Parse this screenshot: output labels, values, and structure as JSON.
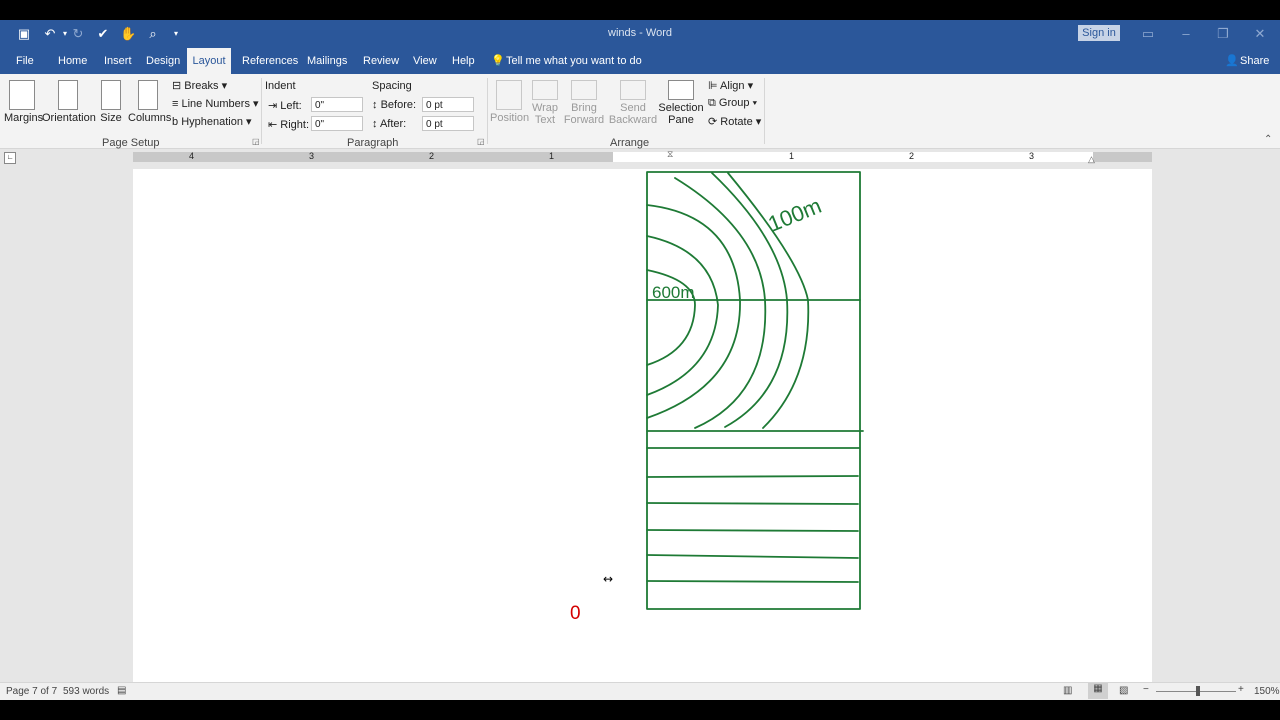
{
  "window": {
    "title": "winds - Word",
    "sign_in": "Sign in",
    "share": "Share"
  },
  "tabs": [
    "File",
    "Home",
    "Insert",
    "Design",
    "Layout",
    "References",
    "Mailings",
    "Review",
    "View",
    "Help"
  ],
  "tell_me": "Tell me what you want to do",
  "ribbon": {
    "page_setup": {
      "margins": "Margins",
      "orientation": "Orientation",
      "size": "Size",
      "columns": "Columns",
      "breaks": "Breaks",
      "line_numbers": "Line Numbers",
      "hyphenation": "Hyphenation",
      "group_label": "Page Setup"
    },
    "paragraph": {
      "indent": "Indent",
      "left_label": "Left:",
      "right_label": "Right:",
      "left_value": "0\"",
      "right_value": "0\"",
      "spacing": "Spacing",
      "before_label": "Before:",
      "after_label": "After:",
      "before_value": "0 pt",
      "after_value": "0 pt",
      "group_label": "Paragraph"
    },
    "arrange": {
      "position": "Position",
      "wrap_text_1": "Wrap",
      "wrap_text_2": "Text",
      "bring_forward_1": "Bring",
      "bring_forward_2": "Forward",
      "send_backward_1": "Send",
      "send_backward_2": "Backward",
      "selection_pane_1": "Selection",
      "selection_pane_2": "Pane",
      "align": "Align",
      "group": "Group",
      "rotate": "Rotate",
      "group_label": "Arrange"
    }
  },
  "ruler": {
    "marks": [
      "4",
      "3",
      "2",
      "1",
      "1",
      "2",
      "3"
    ]
  },
  "drawing": {
    "label_100m": "100m",
    "label_600m": "600m",
    "zero_label": "0"
  },
  "status": {
    "page": "Page 7 of 7",
    "words": "593 words",
    "zoom": "150%"
  },
  "colors": {
    "accent": "#2b579a",
    "ink": "#1e7a35",
    "zero": "#d40000"
  }
}
